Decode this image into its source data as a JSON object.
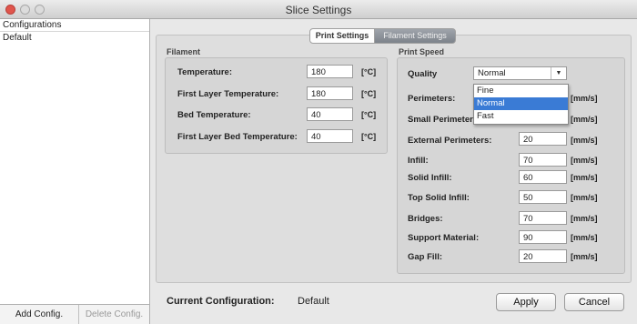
{
  "window": {
    "title": "Slice Settings"
  },
  "sidebar": {
    "items": [
      {
        "label": "Configurations"
      },
      {
        "label": "Default"
      }
    ],
    "add_label": "Add Config.",
    "delete_label": "Delete Config."
  },
  "tabs": [
    {
      "label": "Print Settings",
      "active": false
    },
    {
      "label": "Filament Settings",
      "active": true
    }
  ],
  "filament": {
    "title": "Filament",
    "fields": [
      {
        "label": "Temperature:",
        "value": "180",
        "unit": "[°C]"
      },
      {
        "label": "First Layer Temperature:",
        "value": "180",
        "unit": "[°C]"
      },
      {
        "label": "Bed Temperature:",
        "value": "40",
        "unit": "[°C]"
      },
      {
        "label": "First Layer Bed Temperature:",
        "value": "40",
        "unit": "[°C]"
      }
    ]
  },
  "print_speed": {
    "title": "Print Speed",
    "quality_label": "Quality",
    "quality_value": "Normal",
    "quality_options": [
      "Fine",
      "Normal",
      "Fast"
    ],
    "fields": [
      {
        "label": "Perimeters:",
        "value": "",
        "unit": "[mm/s]"
      },
      {
        "label": "Small Perimeters:",
        "value": "",
        "unit": "[mm/s]"
      },
      {
        "label": "External Perimeters:",
        "value": "20",
        "unit": "[mm/s]"
      },
      {
        "label": "Infill:",
        "value": "70",
        "unit": "[mm/s]"
      },
      {
        "label": "Solid Infill:",
        "value": "60",
        "unit": "[mm/s]"
      },
      {
        "label": "Top Solid Infill:",
        "value": "50",
        "unit": "[mm/s]"
      },
      {
        "label": "Bridges:",
        "value": "70",
        "unit": "[mm/s]"
      },
      {
        "label": "Support Material:",
        "value": "90",
        "unit": "[mm/s]"
      },
      {
        "label": "Gap Fill:",
        "value": "20",
        "unit": "[mm/s]"
      }
    ]
  },
  "footer": {
    "current_label": "Current Configuration:",
    "current_value": "Default",
    "apply_label": "Apply",
    "cancel_label": "Cancel"
  },
  "colors": {
    "close_button": "#e0554c",
    "selection": "#3a7bd5",
    "active_tab": "#8a9098"
  }
}
